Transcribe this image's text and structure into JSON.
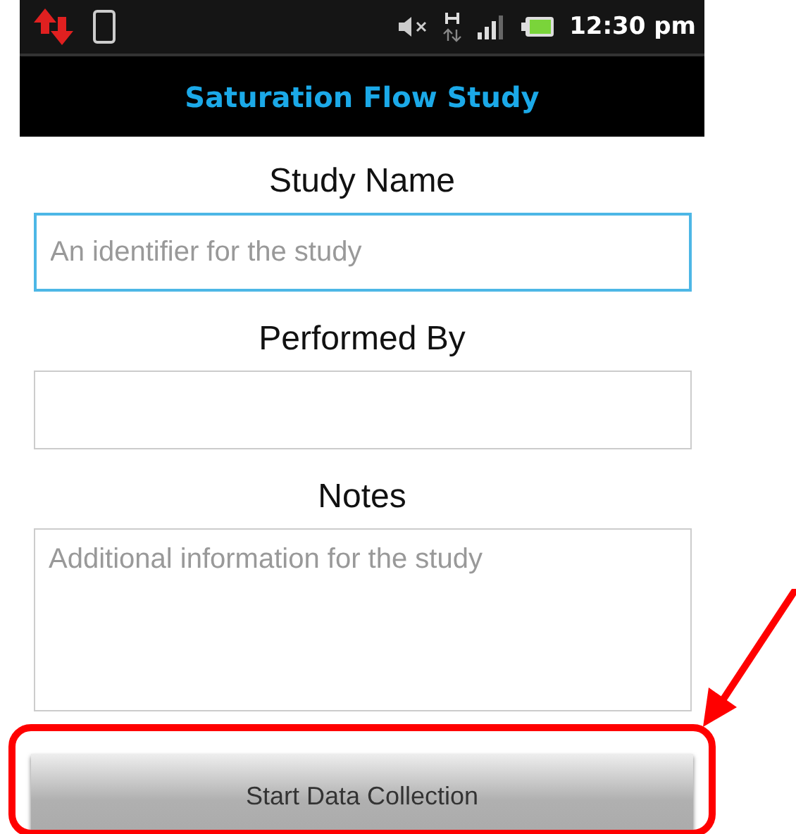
{
  "status_bar": {
    "time": "12:30 pm"
  },
  "app_bar": {
    "title": "Saturation Flow Study"
  },
  "fields": [
    {
      "label": "Study Name",
      "placeholder": "An identifier for the study",
      "kind": "input",
      "focused": true
    },
    {
      "label": "Performed By",
      "kind": "input",
      "focused": false
    },
    {
      "label": "Notes",
      "placeholder": "Additional information for the study",
      "kind": "textarea",
      "focused": false
    }
  ],
  "button": {
    "label": "Start Data Collection",
    "highlighted": true
  }
}
